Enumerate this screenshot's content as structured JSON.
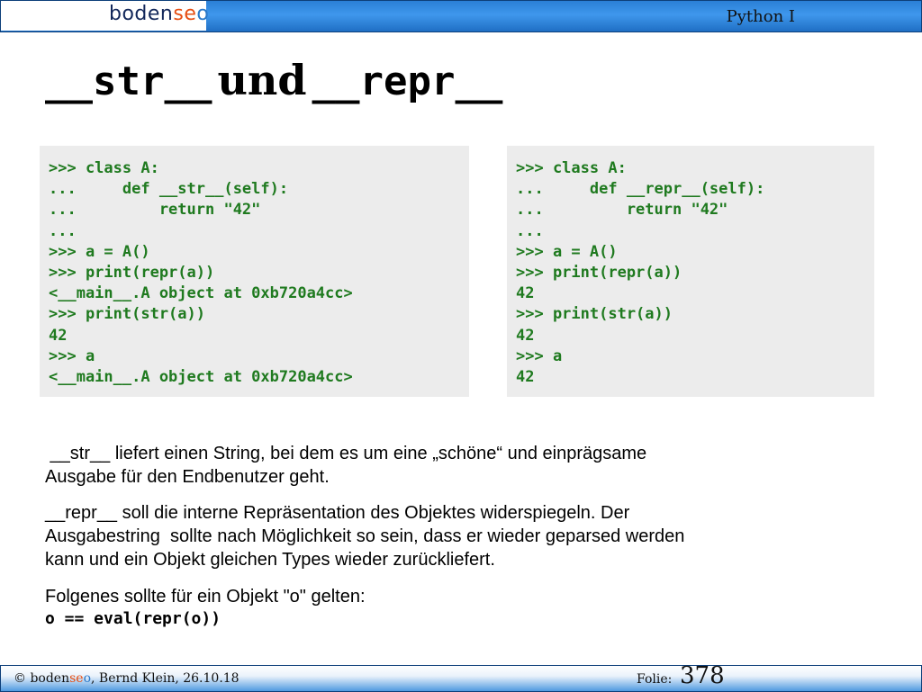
{
  "header": {
    "logo_parts": [
      "boden",
      "se",
      "o"
    ],
    "course": "Python I"
  },
  "title": {
    "part1": "__str__",
    "part2": "und",
    "part3": "__repr__"
  },
  "code_left": [
    ">>> class A:",
    "...     def __str__(self):",
    "...         return \"42\"",
    "...",
    ">>> a = A()",
    ">>> print(repr(a))",
    "<__main__.A object at 0xb720a4cc>",
    ">>> print(str(a))",
    "42",
    ">>> a",
    "<__main__.A object at 0xb720a4cc>"
  ],
  "code_right": [
    ">>> class A:",
    "...     def __repr__(self):",
    "...         return \"42\"",
    "...",
    ">>> a = A()",
    ">>> print(repr(a))",
    "42",
    ">>> print(str(a))",
    "42",
    ">>> a",
    "42"
  ],
  "paragraphs": {
    "p1_line1": " __str__ liefert einen String, bei dem es um eine „schöne“ und einprägsame",
    "p1_line2": "Ausgabe für den Endbenutzer geht.",
    "p2_line1": "__repr__ soll die interne Repräsentation des Objektes widerspiegeln. Der",
    "p2_line2": "Ausgabestring  sollte nach Möglichkeit so sein, dass er wieder geparsed werden",
    "p2_line3": "kann und ein Objekt gleichen Types wieder zurückliefert.",
    "p3": "Folgenes sollte für ein Objekt \"o\" gelten:",
    "formula": "o == eval(repr(o))"
  },
  "footer": {
    "copyright_prefix": "© ",
    "brand_parts": [
      "boden",
      "se",
      "o"
    ],
    "author_date": ", Bernd Klein, 26.10.18",
    "folie_label": "Folie:",
    "folie_number": "378"
  },
  "colors": {
    "code_green": "#1f7a1f",
    "header_blue": "#2a7fd6",
    "brand_orange": "#e64d12",
    "brand_blue": "#2a78c8"
  }
}
